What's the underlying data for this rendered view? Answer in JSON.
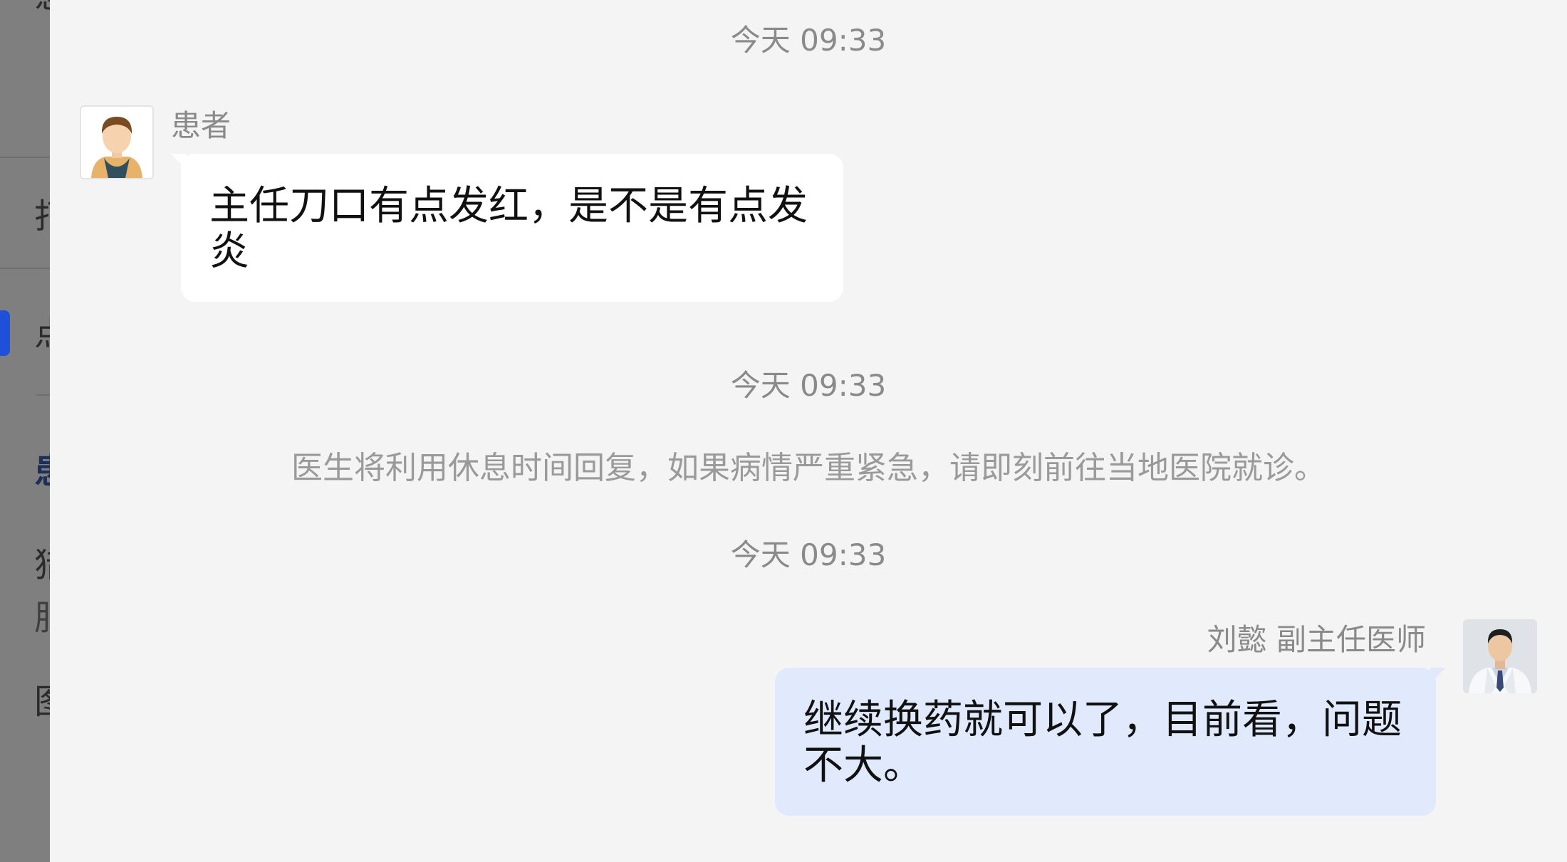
{
  "background": {
    "ghost_chars": [
      "患",
      "打",
      "点",
      "患",
      "猎",
      "服",
      "图"
    ]
  },
  "chat": {
    "messages": [
      {
        "timestamp": "今天 09:33",
        "sender": "患者",
        "direction": "incoming",
        "text": "主任刀口有点发红，是不是有点发炎",
        "avatar_icon": "patient-avatar-icon"
      },
      {
        "timestamp": "今天 09:33",
        "system_notice": "医生将利用休息时间回复，如果病情严重紧急，请即刻前往当地医院就诊。"
      },
      {
        "timestamp": "今天 09:33",
        "sender": "刘懿 副主任医师",
        "direction": "outgoing",
        "text": "继续换药就可以了，目前看，问题不大。",
        "avatar_icon": "doctor-avatar-icon"
      }
    ]
  },
  "colors": {
    "background": "#f4f4f4",
    "incoming_bubble": "#ffffff",
    "outgoing_bubble": "#e0eafc",
    "meta_text": "#8a8a8a",
    "accent": "#1f50d8"
  }
}
